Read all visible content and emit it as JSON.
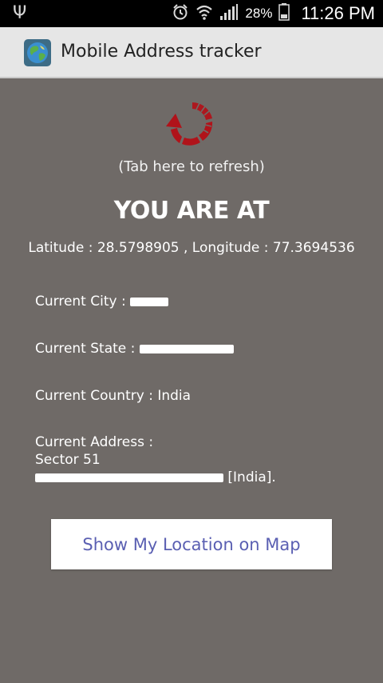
{
  "status_bar": {
    "battery_percent": "28%",
    "time": "11:26 PM",
    "icons": [
      "usb-icon",
      "alarm-icon",
      "wifi-icon",
      "signal-icon",
      "battery-icon"
    ]
  },
  "action_bar": {
    "app_icon": "globe-icon",
    "title": "Mobile Address tracker"
  },
  "main": {
    "refresh_icon": "refresh-icon",
    "refresh_hint": "(Tab here to refresh)",
    "heading": "YOU ARE AT",
    "coordinates": "Latitude : 28.5798905 , Longitude : 77.3694536",
    "city_label": "Current City : ",
    "state_label": "Current State : ",
    "country_label": "Current Country : India",
    "address_label": "Current Address :",
    "address_line1": "Sector 51",
    "address_line2_suffix": "[India].",
    "map_button_label": "Show My Location on Map"
  },
  "colors": {
    "background": "#6f6a67",
    "action_bar": "#e6e6e6",
    "button_text": "#5a5fb2",
    "refresh_red": "#b0131a"
  }
}
